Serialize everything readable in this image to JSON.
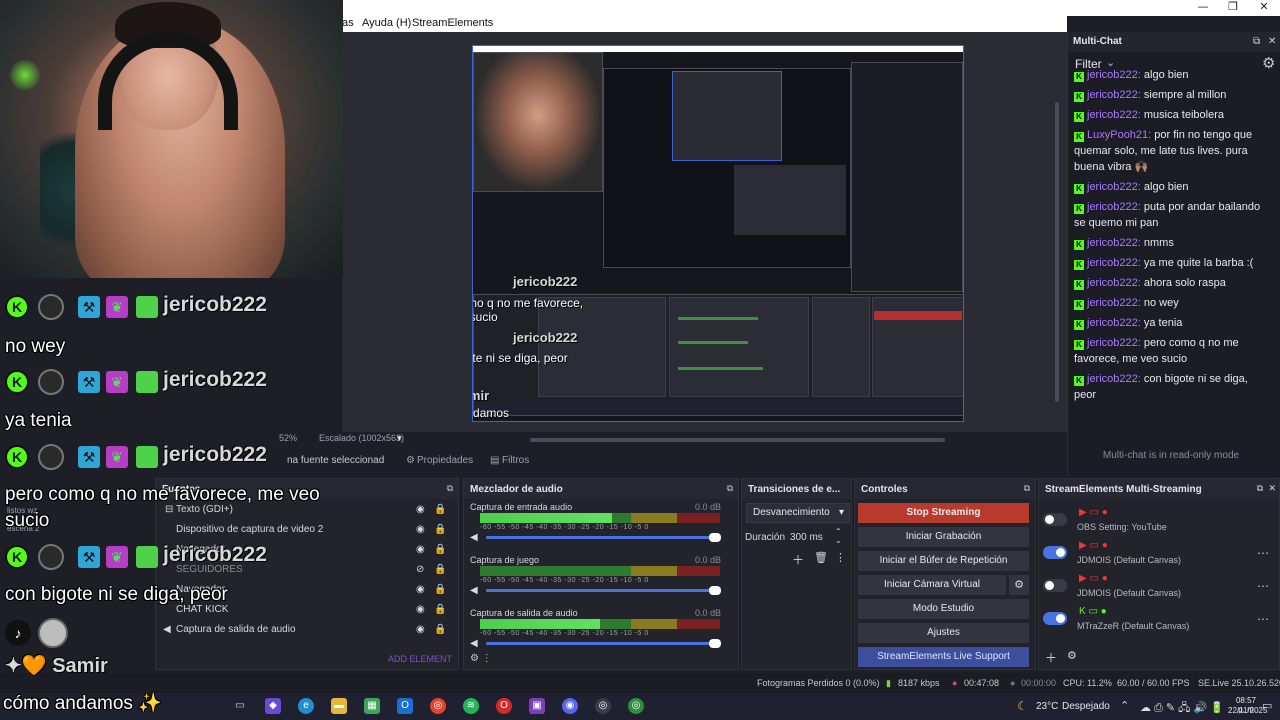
{
  "window": {
    "minimize": "—",
    "restore": "❐",
    "close": "✕"
  },
  "menu": {
    "items": [
      "as",
      "Ayuda (H)",
      "StreamElements"
    ]
  },
  "preview": {
    "zoom": "52%",
    "scale": "Escalado (1002x563)",
    "no_source": "na fuente seleccionad"
  },
  "dock_tabs": {
    "properties": "Propiedades",
    "filters": "Filtros"
  },
  "multichat": {
    "title": "Multi-Chat",
    "filter": "Filter",
    "readonly": "Multi-chat is in read-only mode",
    "messages": [
      {
        "user": "jericob222",
        "text": "algo bien"
      },
      {
        "user": "jericob222",
        "text": "siempre al millon"
      },
      {
        "user": "jericob222",
        "text": "musica teibolera"
      },
      {
        "user": "LuxyPooh21",
        "text": "por fin no tengo que quemar solo, me late tus lives. pura buena vibra 🙌🏽"
      },
      {
        "user": "jericob222",
        "text": "algo bien"
      },
      {
        "user": "jericob222",
        "text": "puta por andar bailando se quemo mi pan"
      },
      {
        "user": "jericob222",
        "text": "nmms"
      },
      {
        "user": "jericob222",
        "text": "ya me quite la barba :("
      },
      {
        "user": "jericob222",
        "text": "ahora solo raspa"
      },
      {
        "user": "jericob222",
        "text": "no wey"
      },
      {
        "user": "jericob222",
        "text": "ya tenia"
      },
      {
        "user": "jericob222",
        "text": "pero como q no me favorece, me veo sucio"
      },
      {
        "user": "jericob222",
        "text": "con bigote ni se diga, peor"
      }
    ]
  },
  "sources": {
    "title": "Fuentes",
    "items": [
      "Texto (GDI+)",
      "Dispositivo de captura de video 2",
      "Navegador",
      "SEGUIDORES",
      "Navegador",
      "CHAT KICK",
      "Captura de salida de audio"
    ],
    "add_element": "ADD ELEMENT",
    "scene_labels": [
      "listos wz",
      "escena 2"
    ]
  },
  "mixer": {
    "title": "Mezclador de audio",
    "scale": "-60 -55 -50 -45 -40 -35 -30 -25 -20 -15 -10 -5 0",
    "channels": [
      {
        "name": "Captura de entrada audio",
        "db": "0.0 dB",
        "level": 0.55
      },
      {
        "name": "Captura de juego",
        "db": "0.0 dB",
        "level": 0.0
      },
      {
        "name": "Captura de salida de audio",
        "db": "0.0 dB",
        "level": 0.5
      }
    ]
  },
  "transitions": {
    "title": "Transiciones de e...",
    "selected": "Desvanecimiento",
    "duration_label": "Duración",
    "duration_value": "300 ms"
  },
  "controls": {
    "title": "Controles",
    "stop_streaming": "Stop Streaming",
    "start_recording": "Iniciar Grabación",
    "replay_buffer": "Iniciar el Búfer de Repetición",
    "virtual_camera": "Iniciar Cámara Virtual",
    "studio_mode": "Modo Estudio",
    "settings": "Ajustes",
    "live_support": "StreamElements Live Support"
  },
  "multistream": {
    "title": "StreamElements Multi-Streaming",
    "rows": [
      {
        "name": "OBS Setting: YouTube",
        "enabled": false
      },
      {
        "name": "JDMOIS (Default Canvas)",
        "enabled": true
      },
      {
        "name": "JDMOIS (Default Canvas)",
        "enabled": false
      },
      {
        "name": "MTraZzeR (Default Canvas)",
        "enabled": true
      }
    ]
  },
  "status": {
    "dropped": "Fotogramas Perdidos 0 (0.0%)",
    "kbps": "8187 kbps",
    "live_time": "00:47:08",
    "rec_time": "00:00:00",
    "cpu": "CPU: 11.2%",
    "fps": "60.00 / 60.00 FPS",
    "version": "SE.Live 25.10.26.520"
  },
  "taskbar": {
    "weather": "23°C",
    "weather_text": "Despejado",
    "time": "08:57 p. m.",
    "date": "22/11/2025"
  },
  "overlay": {
    "lines": [
      {
        "user": "jericob222",
        "text": "no wey"
      },
      {
        "user": "jericob222",
        "text": "ya tenia"
      },
      {
        "user": "jericob222",
        "text": "pero como q no me favorece, me veo sucio"
      },
      {
        "user": "jericob222",
        "text": "con bigote ni se diga, peor"
      }
    ],
    "bottom_user": "Samir",
    "bottom_text": "cómo andamos ✨",
    "nested": {
      "user": "jericob222",
      "lines": [
        "pero como q no me favorece, me veo sucio",
        "con bigote ni se diga, peor"
      ],
      "bottom_user": "Samir",
      "bottom_text": "cómo andamos"
    }
  }
}
